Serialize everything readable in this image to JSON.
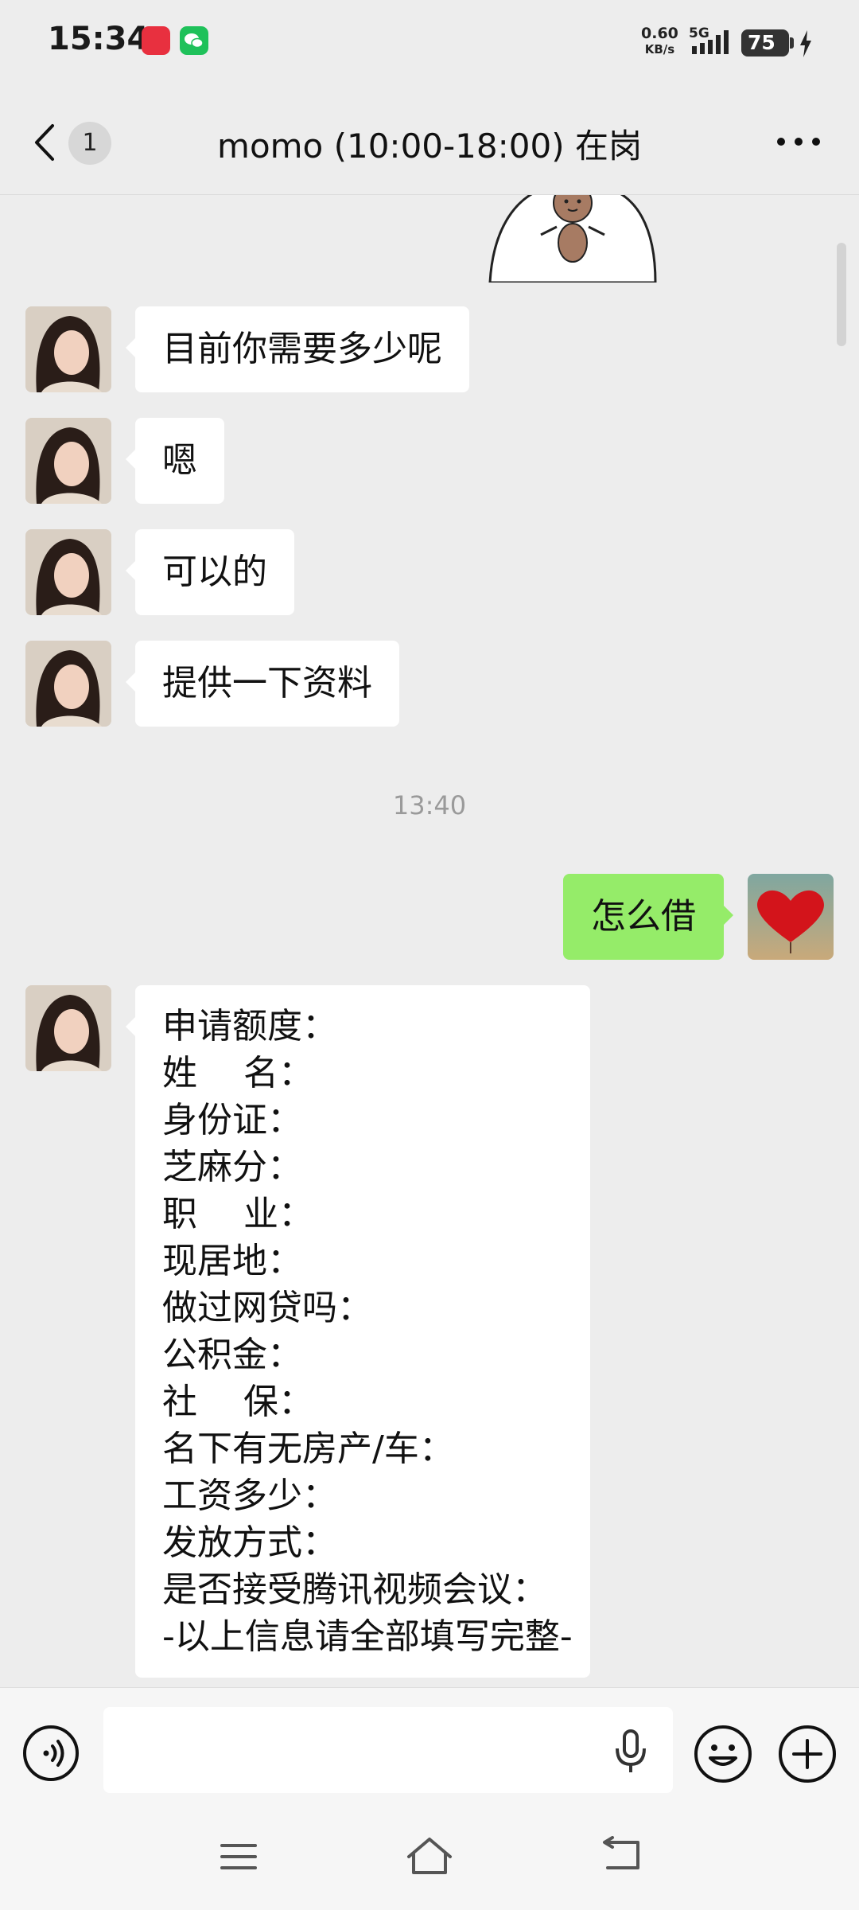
{
  "status_bar": {
    "time": "15:34",
    "badge_red_label": "小红书",
    "net_speed_value": "0.60",
    "net_speed_unit": "KB/s",
    "network": "5G",
    "battery": "75"
  },
  "header": {
    "unread_count": "1",
    "title": "momo (10:00-18:00) 在岗"
  },
  "messages": [
    {
      "side": "in",
      "text": "目前你需要多少呢"
    },
    {
      "side": "in",
      "text": "嗯"
    },
    {
      "side": "in",
      "text": "可以的"
    },
    {
      "side": "in",
      "text": "提供一下资料"
    },
    {
      "type": "time",
      "text": "13:40"
    },
    {
      "side": "out",
      "text": "怎么借"
    }
  ],
  "form_message": {
    "lines": [
      "申请额度：",
      "姓　 名：",
      "身份证：",
      "芝麻分：",
      "职　 业：",
      "现居地：",
      "做过网贷吗：",
      "公积金：",
      "社　 保：",
      "名下有无房产/车：",
      "工资多少：",
      "发放方式：",
      "是否接受腾讯视频会议：",
      "-以上信息请全部填写完整-"
    ]
  },
  "input": {
    "placeholder": ""
  },
  "icons": {
    "back": "chevron-left-icon",
    "more": "more-dots-icon",
    "voice": "voice-icon",
    "mic": "mic-icon",
    "emoji": "emoji-icon",
    "plus": "plus-icon"
  },
  "colors": {
    "chat_bg": "#ededed",
    "bubble_in": "#ffffff",
    "bubble_out": "#95ec69"
  }
}
